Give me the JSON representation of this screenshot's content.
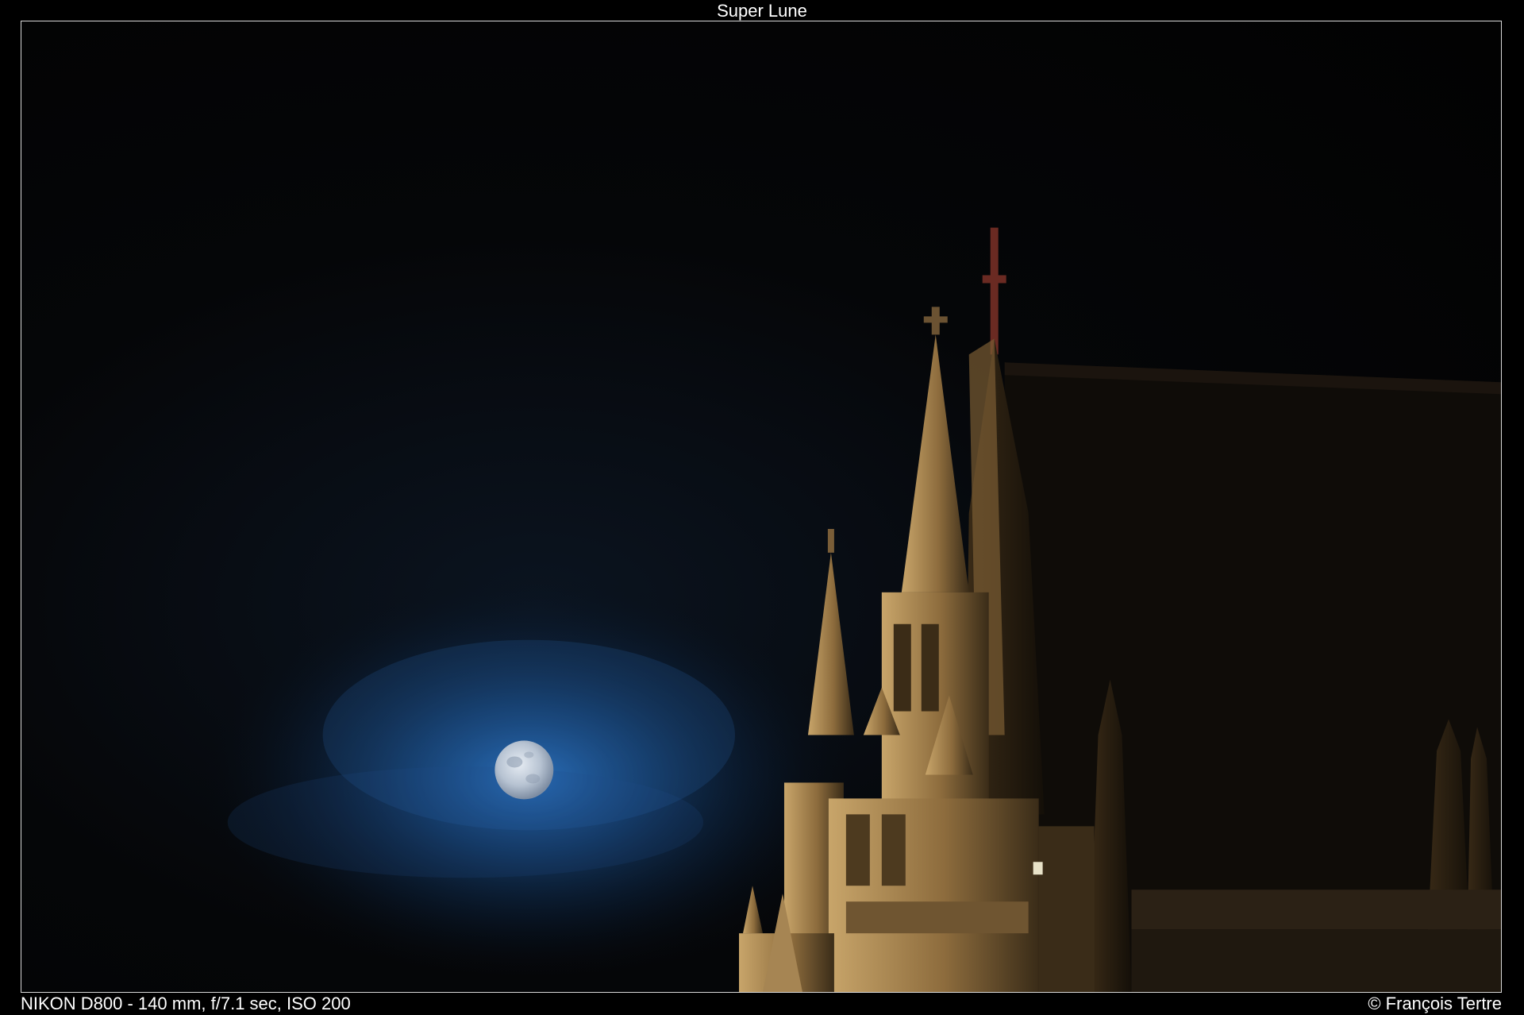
{
  "title": "Super Lune",
  "caption": {
    "exif": "NIKON D800 - 140 mm, f/7.1 sec, ISO 200",
    "copyright": "© François Tertre"
  },
  "colors": {
    "sky": "#030304",
    "moon_halo": "#1e5fa8",
    "moon": "#c9d2de",
    "stone_lit": "#a0814e",
    "stone_shadow": "#2b2114"
  }
}
